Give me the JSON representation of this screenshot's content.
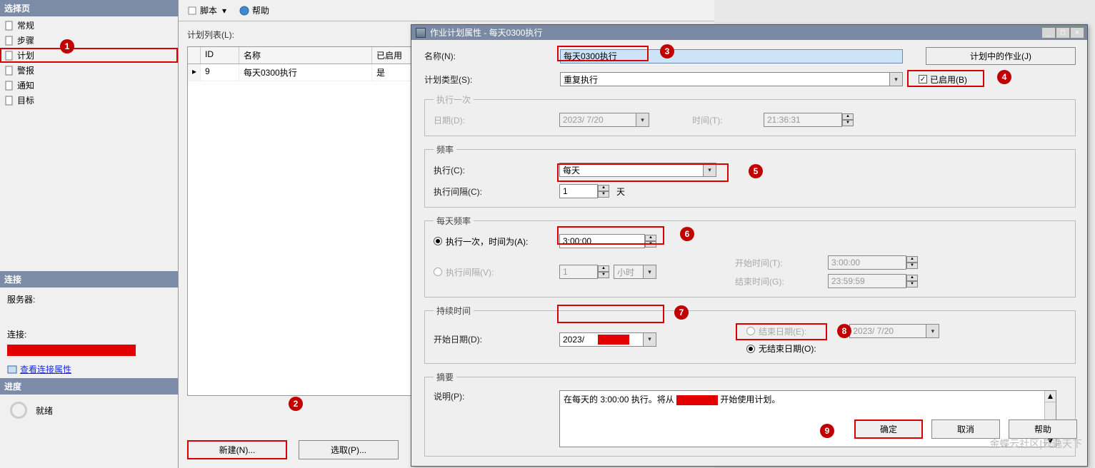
{
  "left": {
    "header_select": "选择页",
    "nav": [
      "常规",
      "步骤",
      "计划",
      "警报",
      "通知",
      "目标"
    ],
    "header_conn": "连接",
    "server_label": "服务器:",
    "conn_label": "连接:",
    "view_conn": "查看连接属性",
    "header_prog": "进度",
    "prog_status": "就绪"
  },
  "main": {
    "tb_script": "脚本",
    "tb_help": "帮助",
    "list_label": "计划列表(L):",
    "cols": {
      "id": "ID",
      "name": "名称",
      "enabled": "已启用"
    },
    "row": {
      "id": "9",
      "name": "每天0300执行",
      "enabled": "是"
    },
    "btn_new": "新建(N)...",
    "btn_pick": "选取(P)..."
  },
  "dlg": {
    "title": "作业计划属性 - 每天0300执行",
    "name_lbl": "名称(N):",
    "name_val": "每天0300执行",
    "jobs_btn": "计划中的作业(J)",
    "type_lbl": "计划类型(S):",
    "type_val": "重复执行",
    "enabled_lbl": "已启用(B)",
    "once_group": "执行一次",
    "once_date_lbl": "日期(D):",
    "once_date_val": "2023/ 7/20",
    "once_time_lbl": "时间(T):",
    "once_time_val": "21:36:31",
    "freq_group": "频率",
    "exec_lbl": "执行(C):",
    "exec_val": "每天",
    "interval_lbl": "执行间隔(C):",
    "interval_val": "1",
    "interval_unit": "天",
    "daily_group": "每天频率",
    "daily_once_lbl": "执行一次，时间为(A):",
    "daily_once_val": "3:00:00",
    "daily_int_lbl": "执行间隔(V):",
    "daily_int_val": "1",
    "daily_int_unit": "小时",
    "start_time_lbl": "开始时间(T):",
    "start_time_val": "3:00:00",
    "end_time_lbl": "结束时间(G):",
    "end_time_val": "23:59:59",
    "dur_group": "持续时间",
    "start_date_lbl": "开始日期(D):",
    "start_date_val": "2023/",
    "end_date_lbl": "结束日期(E):",
    "end_date_val": "2023/ 7/20",
    "no_end_lbl": "无结束日期(O):",
    "summary_group": "摘要",
    "desc_lbl": "说明(P):",
    "desc_p1": "在每天的 3:00:00 执行。将从",
    "desc_p2": "开始使用计划。",
    "ok": "确定",
    "cancel": "取消",
    "help": "帮助"
  },
  "badges": [
    "1",
    "2",
    "3",
    "4",
    "5",
    "6",
    "7",
    "8",
    "9"
  ],
  "watermark": "金蝶云社区|云逸天下"
}
